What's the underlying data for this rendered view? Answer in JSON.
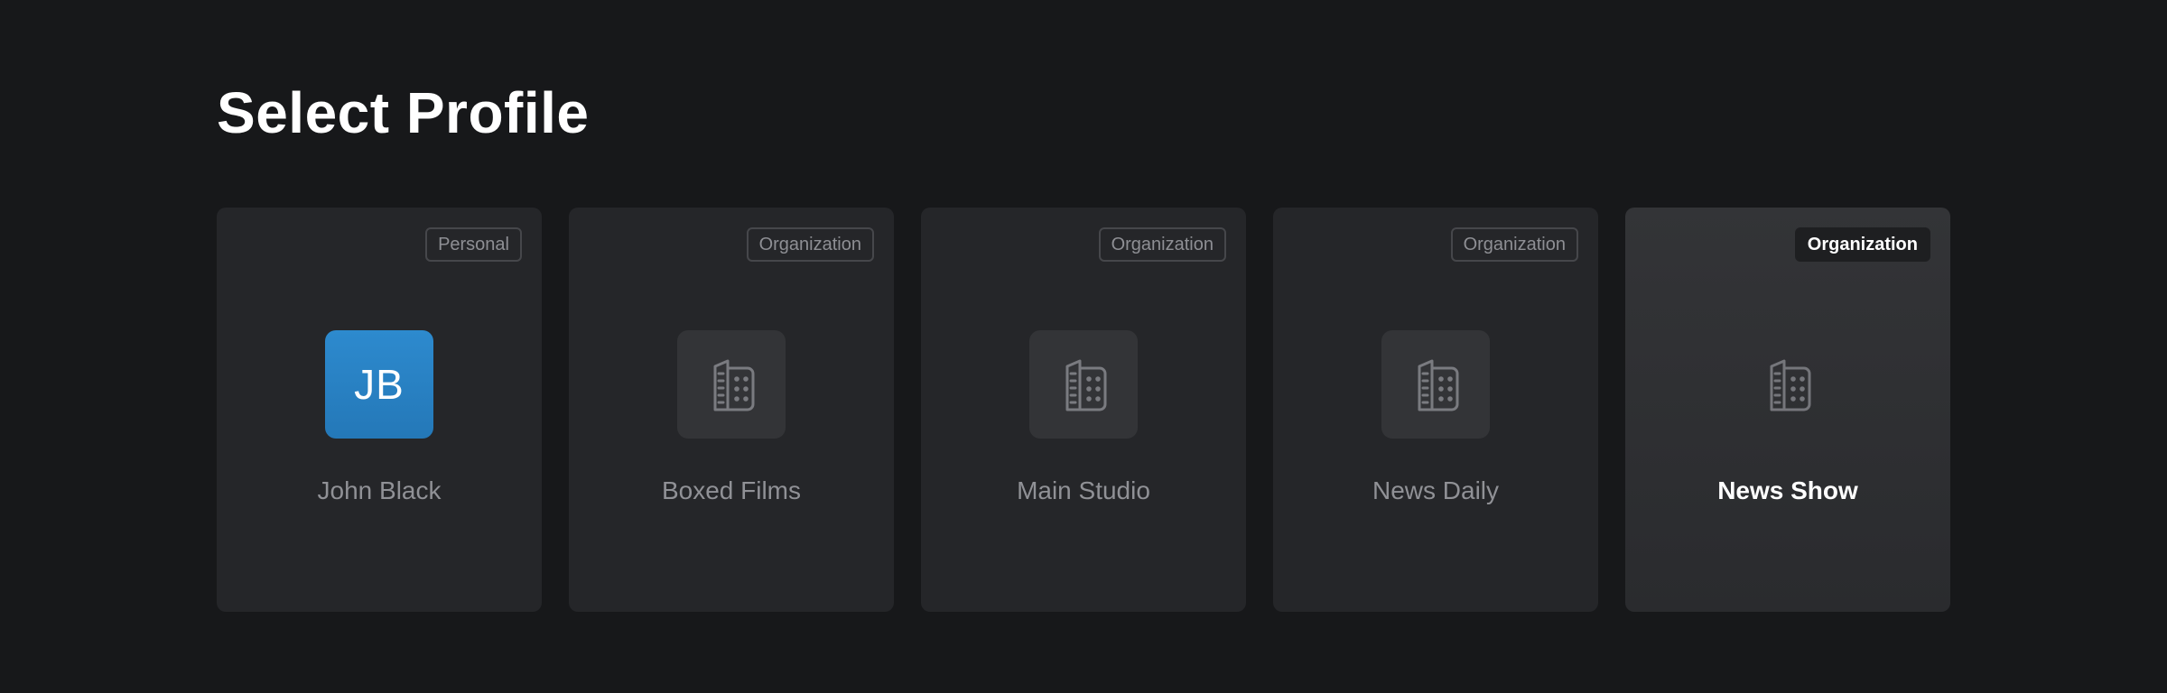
{
  "page": {
    "title": "Select Profile"
  },
  "profiles": [
    {
      "name": "John Black",
      "type": "Personal",
      "avatar": "initials",
      "initials": "JB",
      "selected": false
    },
    {
      "name": "Boxed Films",
      "type": "Organization",
      "avatar": "building-icon",
      "selected": false
    },
    {
      "name": "Main Studio",
      "type": "Organization",
      "avatar": "building-icon",
      "selected": false
    },
    {
      "name": "News Daily",
      "type": "Organization",
      "avatar": "building-icon",
      "selected": false
    },
    {
      "name": "News Show",
      "type": "Organization",
      "avatar": "building-icon",
      "selected": true
    }
  ],
  "colors": {
    "background": "#17181a",
    "card": "#252629",
    "card_selected": "#333437",
    "avatar_personal": "#2a82c4",
    "text_muted": "#909196",
    "text_active": "#ffffff"
  }
}
